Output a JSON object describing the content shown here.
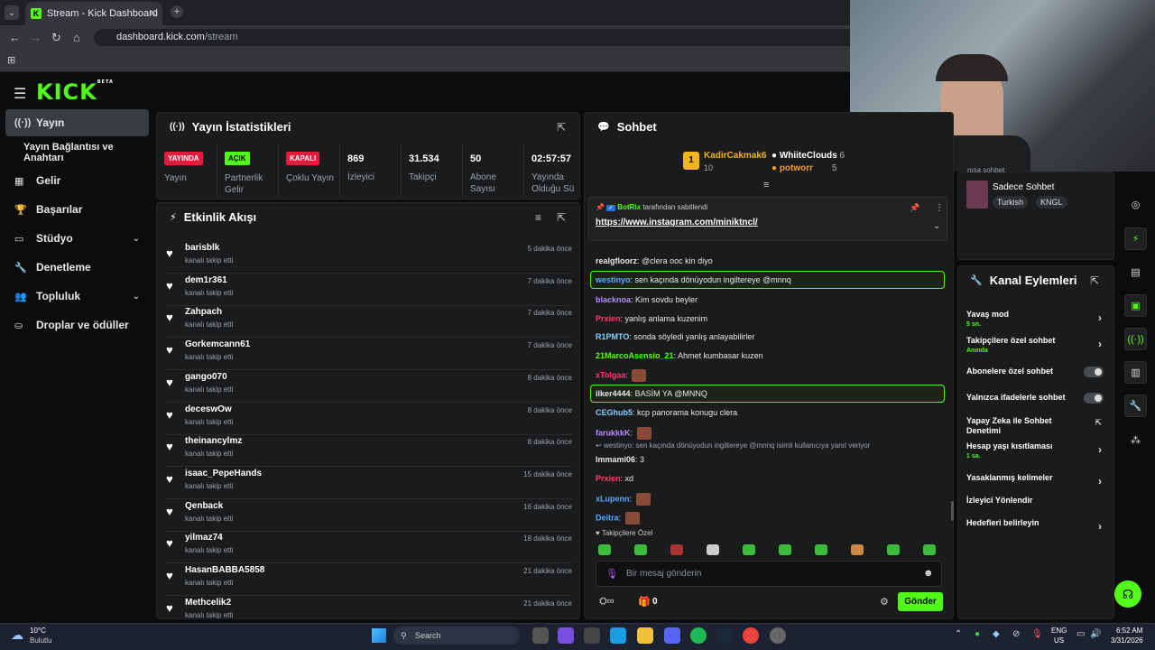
{
  "browser": {
    "tab_title": "Stream - Kick Dashboard",
    "url_domain": "dashboard.kick.com",
    "url_path": "/stream"
  },
  "brand": {
    "logo": "KICK",
    "beta": "BETA",
    "accent": "#53fc18"
  },
  "sidebar": {
    "items": [
      {
        "label": "Yayın",
        "icon": "broadcast-icon"
      },
      {
        "label": "Yayın Bağlantısı ve Anahtarı",
        "icon": ""
      },
      {
        "label": "Gelir",
        "icon": "money-icon"
      },
      {
        "label": "Başarılar",
        "icon": "trophy-icon"
      },
      {
        "label": "Stüdyo",
        "icon": "studio-icon"
      },
      {
        "label": "Denetleme",
        "icon": "wrench-icon"
      },
      {
        "label": "Topluluk",
        "icon": "community-icon"
      },
      {
        "label": "Droplar ve ödüller",
        "icon": "drops-icon"
      }
    ]
  },
  "stats": {
    "title": "Yayın İstatistikleri",
    "cells": [
      {
        "badge": "YAYINDA",
        "label": "Yayın"
      },
      {
        "badge": "AÇIK",
        "label": "Partnerlik Gelir"
      },
      {
        "badge": "KAPALI",
        "label": "Çoklu Yayın"
      },
      {
        "value": "869",
        "label": "İzleyici"
      },
      {
        "value": "31.534",
        "label": "Takipçi"
      },
      {
        "value": "50",
        "label": "Abone Sayısı"
      },
      {
        "value": "02:57:57",
        "label": "Yayında Olduğu Sü"
      }
    ]
  },
  "activity": {
    "title": "Etkinlik Akışı",
    "items": [
      {
        "user": "barisblk",
        "action": "kanalı takip etti",
        "time": "5 dakika önce"
      },
      {
        "user": "dem1r361",
        "action": "kanalı takip etti",
        "time": "7 dakika önce"
      },
      {
        "user": "Zahpach",
        "action": "kanalı takip etti",
        "time": "7 dakika önce"
      },
      {
        "user": "Gorkemcann61",
        "action": "kanalı takip etti",
        "time": "7 dakika önce"
      },
      {
        "user": "gango070",
        "action": "kanalı takip etti",
        "time": "8 dakika önce"
      },
      {
        "user": "deceswOw",
        "action": "kanalı takip etti",
        "time": "8 dakika önce"
      },
      {
        "user": "theinancylmz",
        "action": "kanalı takip etti",
        "time": "8 dakika önce"
      },
      {
        "user": "isaac_PepeHands",
        "action": "kanalı takip etti",
        "time": "15 dakika önce"
      },
      {
        "user": "Qenback",
        "action": "kanalı takip etti",
        "time": "16 dakika önce"
      },
      {
        "user": "yilmaz74",
        "action": "kanalı takip etti",
        "time": "18 dakika önce"
      },
      {
        "user": "HasanBABBA5858",
        "action": "kanalı takip etti",
        "time": "21 dakika önce"
      },
      {
        "user": "Methcelik2",
        "action": "kanalı takip etti",
        "time": "21 dakika önce"
      }
    ]
  },
  "chat": {
    "title": "Sohbet",
    "leaders": [
      {
        "rank": "1",
        "name": "KadirCakmak6",
        "count": "10"
      },
      {
        "name": "WhiiteClouds",
        "count": "6"
      },
      {
        "name": "potworr",
        "count": "5"
      }
    ],
    "pinned_by": "BotRix",
    "pinned_suffix": "tarafından sabitlendi",
    "pinned_link": "https://www.instagram.com/miniktncl/",
    "messages": [
      {
        "user": "realgfloorz",
        "text": "@clera ooc kin diyo",
        "color": "#e6e8ea"
      },
      {
        "user": "westinyo",
        "text": "sen kaçında dönüyodun ingiltereye @mnnq",
        "color": "#5aa9ff",
        "highlight": true
      },
      {
        "user": "blacknoa",
        "text": "Kim sovdu beyler",
        "color": "#b78cff"
      },
      {
        "user": "Prxien",
        "text": "yanlış anlama kuzenim",
        "color": "#ff3c6e"
      },
      {
        "user": "R1PMTO",
        "text": "sonda söyledi yanlış anlayabilirler",
        "color": "#7fd3ff"
      },
      {
        "user": "21MarcoAsensio_21",
        "text": "Ahmet kumbasar kuzen",
        "color": "#53fc18"
      },
      {
        "user": "xTolgaa",
        "text": "",
        "color": "#ff3c6e",
        "emote": true
      },
      {
        "user": "ilker4444",
        "text": "BASİM YA @MNNQ",
        "color": "#e6e8ea",
        "highlight": true
      },
      {
        "user": "CEGhub5",
        "text": "kcp panorama konugu clera",
        "color": "#7fd3ff"
      },
      {
        "user": "farukkkK",
        "text": "",
        "color": "#b78cff",
        "emote": true
      },
      {
        "user": "Immami06",
        "text": "3",
        "color": "#e6e8ea"
      },
      {
        "user": "Prxien",
        "text": "xd",
        "color": "#ff3c6e"
      },
      {
        "user": "xLupenn",
        "text": "",
        "color": "#5aa9ff",
        "emote": true
      },
      {
        "user": "Deitra",
        "text": "",
        "color": "#5aa9ff",
        "emote": true
      }
    ],
    "reply_context": "westinyo: sen kaçında dönüyodun ingiltereye @mnnq isimli kullanıcıya yanıt veriyor",
    "followers_only": "Takipçilere Özel",
    "input_placeholder": "Bir mesaj gönderin",
    "points": "0",
    "send_label": "Gönder"
  },
  "right_panel": {
    "partial_label": "nısa sohbet",
    "sub_only_chat": "Sadece Sohbet",
    "tags": [
      "Turkish",
      "KNGL"
    ],
    "actions_title": "Kanal Eylemleri",
    "actions": [
      {
        "label": "Yavaş mod",
        "sub": "5 sn.",
        "control": "arrow"
      },
      {
        "label": "Takipçilere özel sohbet",
        "sub": "Anında",
        "control": "arrow"
      },
      {
        "label": "Abonelere özel sohbet",
        "sub": "",
        "control": "toggle"
      },
      {
        "label": "Yalnızca ifadelerle sohbet",
        "sub": "",
        "control": "toggle"
      },
      {
        "label": "Yapay Zeka ile Sohbet Denetimi",
        "sub": "",
        "control": "external"
      },
      {
        "label": "Hesap yaşı kısıtlaması",
        "sub": "1 sa.",
        "control": "arrow"
      },
      {
        "label": "Yasaklanmış kelimeler",
        "sub": "",
        "control": "arrow"
      },
      {
        "label": "İzleyici Yönlendir",
        "sub": "",
        "control": "none"
      },
      {
        "label": "Hedefleri belirleyin",
        "sub": "",
        "control": "arrow"
      }
    ]
  },
  "taskbar": {
    "weather_temp": "10°C",
    "weather_desc": "Bulutlu",
    "search": "Search",
    "lang": "ENG",
    "region": "US",
    "time": "6:52 AM",
    "date": "3/31/2026"
  }
}
